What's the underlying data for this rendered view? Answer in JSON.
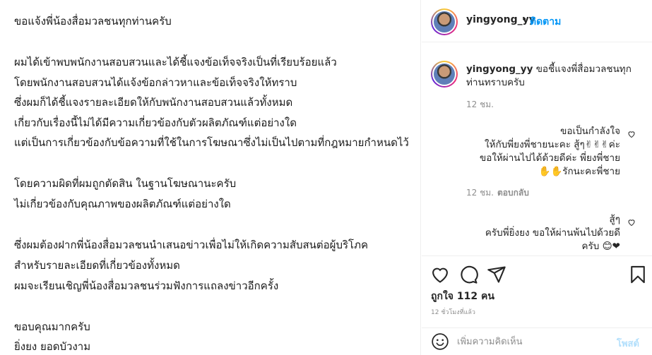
{
  "post": {
    "lines": [
      "ขอแจ้งพี่น้องสื่อมวลชนทุกท่านครับ",
      "ผมได้เข้าพบพนักงานสอบสวนและได้ชี้แจงข้อเท็จจริงเป็นที่เรียบร้อยแล้ว",
      "โดยพนักงานสอบสวนได้แจ้งข้อกล่าวหาและข้อเท็จจริงให้ทราบ",
      "ซึ่งผมก็ได้ชี้แจงรายละเอียดให้กับพนักงานสอบสวนแล้วทั้งหมด",
      "เกี่ยวกับเรื่องนี้ไม่ได้มีความเกี่ยวข้องกับตัวผลิตภัณฑ์แต่อย่างใด",
      "แต่เป็นการเกี่ยวข้องกับข้อความที่ใช้ในการโฆษณาซึ่งไม่เป็นไปตามที่กฎหมายกำหนดไว้",
      "โดยความผิดที่ผมถูกตัดสิน ในฐานโฆษณานะครับ",
      "ไม่เกี่ยวข้องกับคุณภาพของผลิตภัณฑ์แต่อย่างใด",
      "ซึ่งผมต้องฝากพี่น้องสื่อมวลชนนำเสนอข่าวเพื่อไม่ให้เกิดความสับสนต่อผู้บริโภค",
      "สำหรับรายละเอียดที่เกี่ยวข้องทั้งหมด",
      "ผมจะเรียนเชิญพี่น้องสื่อมวลชนร่วมฟังการแถลงข่าวอีกครั้ง",
      "ขอบคุณมากครับ",
      "ยิ่งยง ยอดบัวงาม"
    ]
  },
  "header": {
    "username": "yingyong_yy",
    "dot": "•",
    "follow_label": "ติดตาม"
  },
  "caption": {
    "username": "yingyong_yy",
    "text": "ขอชี้แจงพี่สื่อมวลชนทุกท่านทราบครับ",
    "time": "12 ชม."
  },
  "comments": [
    {
      "line1": "ขอเป็นกำลังใจ",
      "line2": "ให้กับพี่ยงพี่ชายนะคะ สู้ๆ✌✌✌ค่ะ",
      "line3": "ขอให้ผ่านไปได้ด้วยดีค่ะ พี่ยงพี่ชาย",
      "line4": "✋✋รักนะคะพี่ชาย",
      "time": "12 ชม.",
      "reply_label": "ตอบกลับ"
    },
    {
      "line1": "สู้ๆ",
      "line2": "ครับพี่ยิ่งยง ขอให้ผ่านพ้นไปด้วยดี",
      "line3": "ครับ 😊❤"
    }
  ],
  "actions": {
    "likes": "ถูกใจ 112 คน",
    "time_ago": "12 ชั่วโมงที่แล้ว",
    "icons": [
      "heart-icon",
      "comment-icon",
      "share-icon",
      "bookmark-icon"
    ]
  },
  "comment_bar": {
    "placeholder": "เพิ่มความคิดเห็น",
    "post_label": "โพสต์"
  },
  "colors": {
    "link_blue": "#0095f6",
    "post_disabled": "#b2dffc",
    "muted": "#8e8e8e",
    "text": "#262626"
  }
}
